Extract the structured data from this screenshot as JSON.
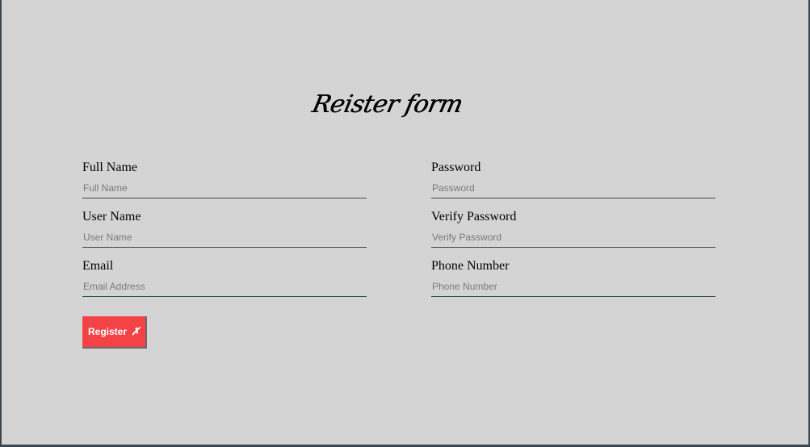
{
  "form": {
    "title": "Reister form",
    "fields": [
      {
        "label": "Full Name",
        "placeholder": "Full Name",
        "value": ""
      },
      {
        "label": "Password",
        "placeholder": "Password",
        "value": ""
      },
      {
        "label": "User Name",
        "placeholder": "User Name",
        "value": ""
      },
      {
        "label": "Verify Password",
        "placeholder": "Verify Password",
        "value": ""
      },
      {
        "label": "Email",
        "placeholder": "Email Address",
        "value": ""
      },
      {
        "label": "Phone Number",
        "placeholder": "Phone Number",
        "value": ""
      }
    ],
    "submit": {
      "label": "Register",
      "icon": "✗",
      "icon_name": "cross-icon",
      "color": "#f44347"
    }
  },
  "colors": {
    "background": "#d4d4d4",
    "frame": "#3a4650",
    "input_underline": "#2f4f4f",
    "placeholder": "#7a7a7a"
  }
}
